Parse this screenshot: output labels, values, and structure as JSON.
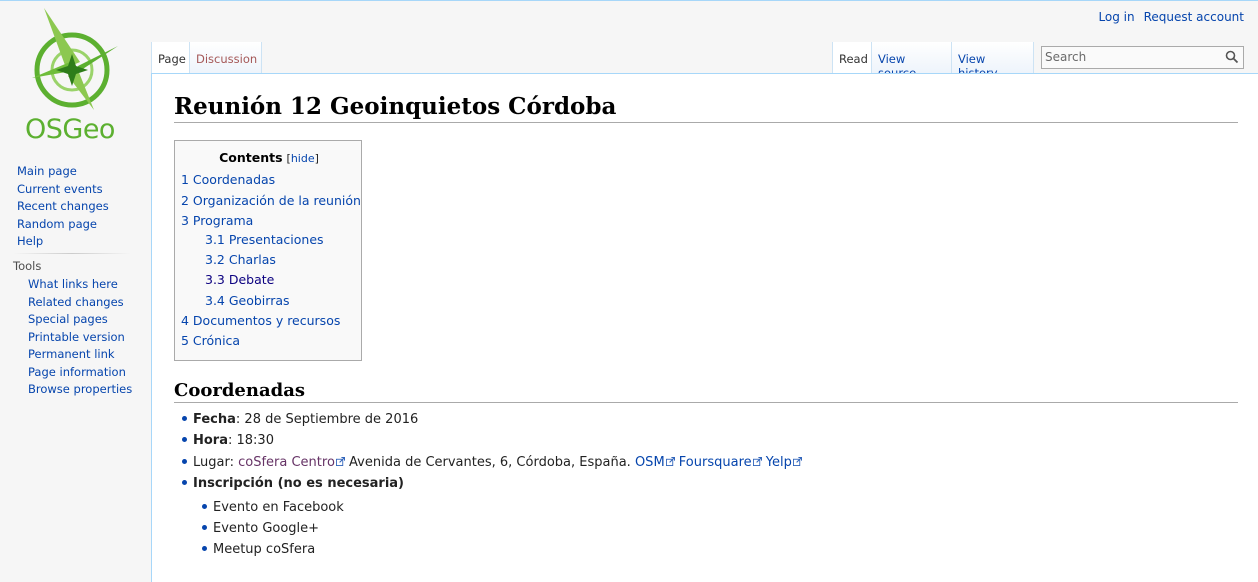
{
  "logo": {
    "text": "OSGeo",
    "accent": "#5cb030"
  },
  "personal": {
    "login": "Log in",
    "request_account": "Request account"
  },
  "tabs": {
    "page": "Page",
    "discussion": "Discussion",
    "read": "Read",
    "view_source": "View source",
    "view_history": "View history"
  },
  "search": {
    "placeholder": "Search",
    "icon": "magnifier-icon"
  },
  "sidebar": {
    "navigation": [
      "Main page",
      "Current events",
      "Recent changes",
      "Random page",
      "Help"
    ],
    "tools_heading": "Tools",
    "tools": [
      "What links here",
      "Related changes",
      "Special pages",
      "Printable version",
      "Permanent link",
      "Page information",
      "Browse properties"
    ]
  },
  "page": {
    "title": "Reunión 12 Geoinquietos Córdoba"
  },
  "toc": {
    "title": "Contents",
    "hide_open": "[",
    "hide": "hide",
    "hide_close": "]",
    "items": [
      "1 Coordenadas",
      "2 Organización de la reunión",
      "3 Programa",
      "3.1 Presentaciones",
      "3.2 Charlas",
      "3.3 Debate",
      "3.4 Geobirras",
      "4 Documentos y recursos",
      "5 Crónica"
    ]
  },
  "section": {
    "heading": "Coordenadas",
    "fecha_label": "Fecha",
    "fecha_value": ": 28 de Septiembre de 2016",
    "hora_label": "Hora",
    "hora_value": ": 18:30",
    "lugar_prefix": "Lugar: ",
    "lugar_link": "coSfera Centro",
    "lugar_address": " Avenida de Cervantes, 6, Córdoba, España. ",
    "osm": "OSM",
    "foursquare": "Foursquare",
    "yelp": "Yelp",
    "inscripcion": "Inscripción (no es necesaria)",
    "sub_items": [
      "Evento en Facebook",
      "Evento Google+",
      "Meetup coSfera"
    ]
  }
}
